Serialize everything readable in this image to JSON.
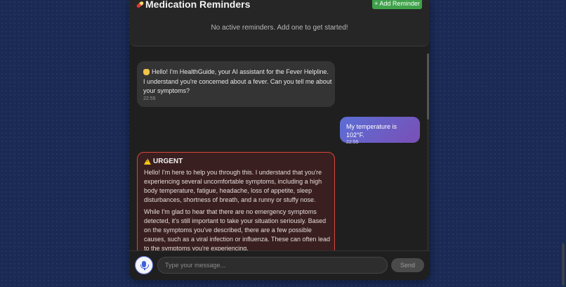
{
  "reminders": {
    "title": "Medication Reminders",
    "title_icon": "pill-icon",
    "add_button": "+ Add Reminder",
    "empty_text": "No active reminders. Add one to get started!"
  },
  "messages": [
    {
      "role": "assistant",
      "icon": "waving-hand-icon",
      "line1": "Hello! I'm HealthGuide, your AI assistant for the Fever Helpline.",
      "line2": "I understand you're concerned about a fever. Can you tell me about your symptoms?",
      "time": "22:55"
    },
    {
      "role": "user",
      "text": "My temperature is 102°F.",
      "time": "22:55"
    },
    {
      "role": "assistant-urgent",
      "badge_icon": "warning-icon",
      "badge": "URGENT",
      "p1": "Hello! I'm here to help you through this. I understand that you're experiencing several uncomfortable symptoms, including a high body temperature, fatigue, headache, loss of appetite, sleep disturbances, shortness of breath, and a runny or stuffy nose.",
      "p2": "While I'm glad to hear that there are no emergency symptoms detected, it's still important to take your situation seriously. Based on the symptoms you've described, there are a few possible causes, such as a viral infection or influenza. These can often lead to the symptoms you're experiencing."
    }
  ],
  "composer": {
    "placeholder": "Type your message...",
    "send_label": "Send",
    "mic_icon": "microphone-icon"
  },
  "colors": {
    "background": "#1a2a55",
    "panel": "#1f1f1f",
    "add_button": "#3fa14a",
    "user_bubble_start": "#5b6fd6",
    "user_bubble_end": "#7a4fb5",
    "urgent_border": "#d9463b"
  }
}
